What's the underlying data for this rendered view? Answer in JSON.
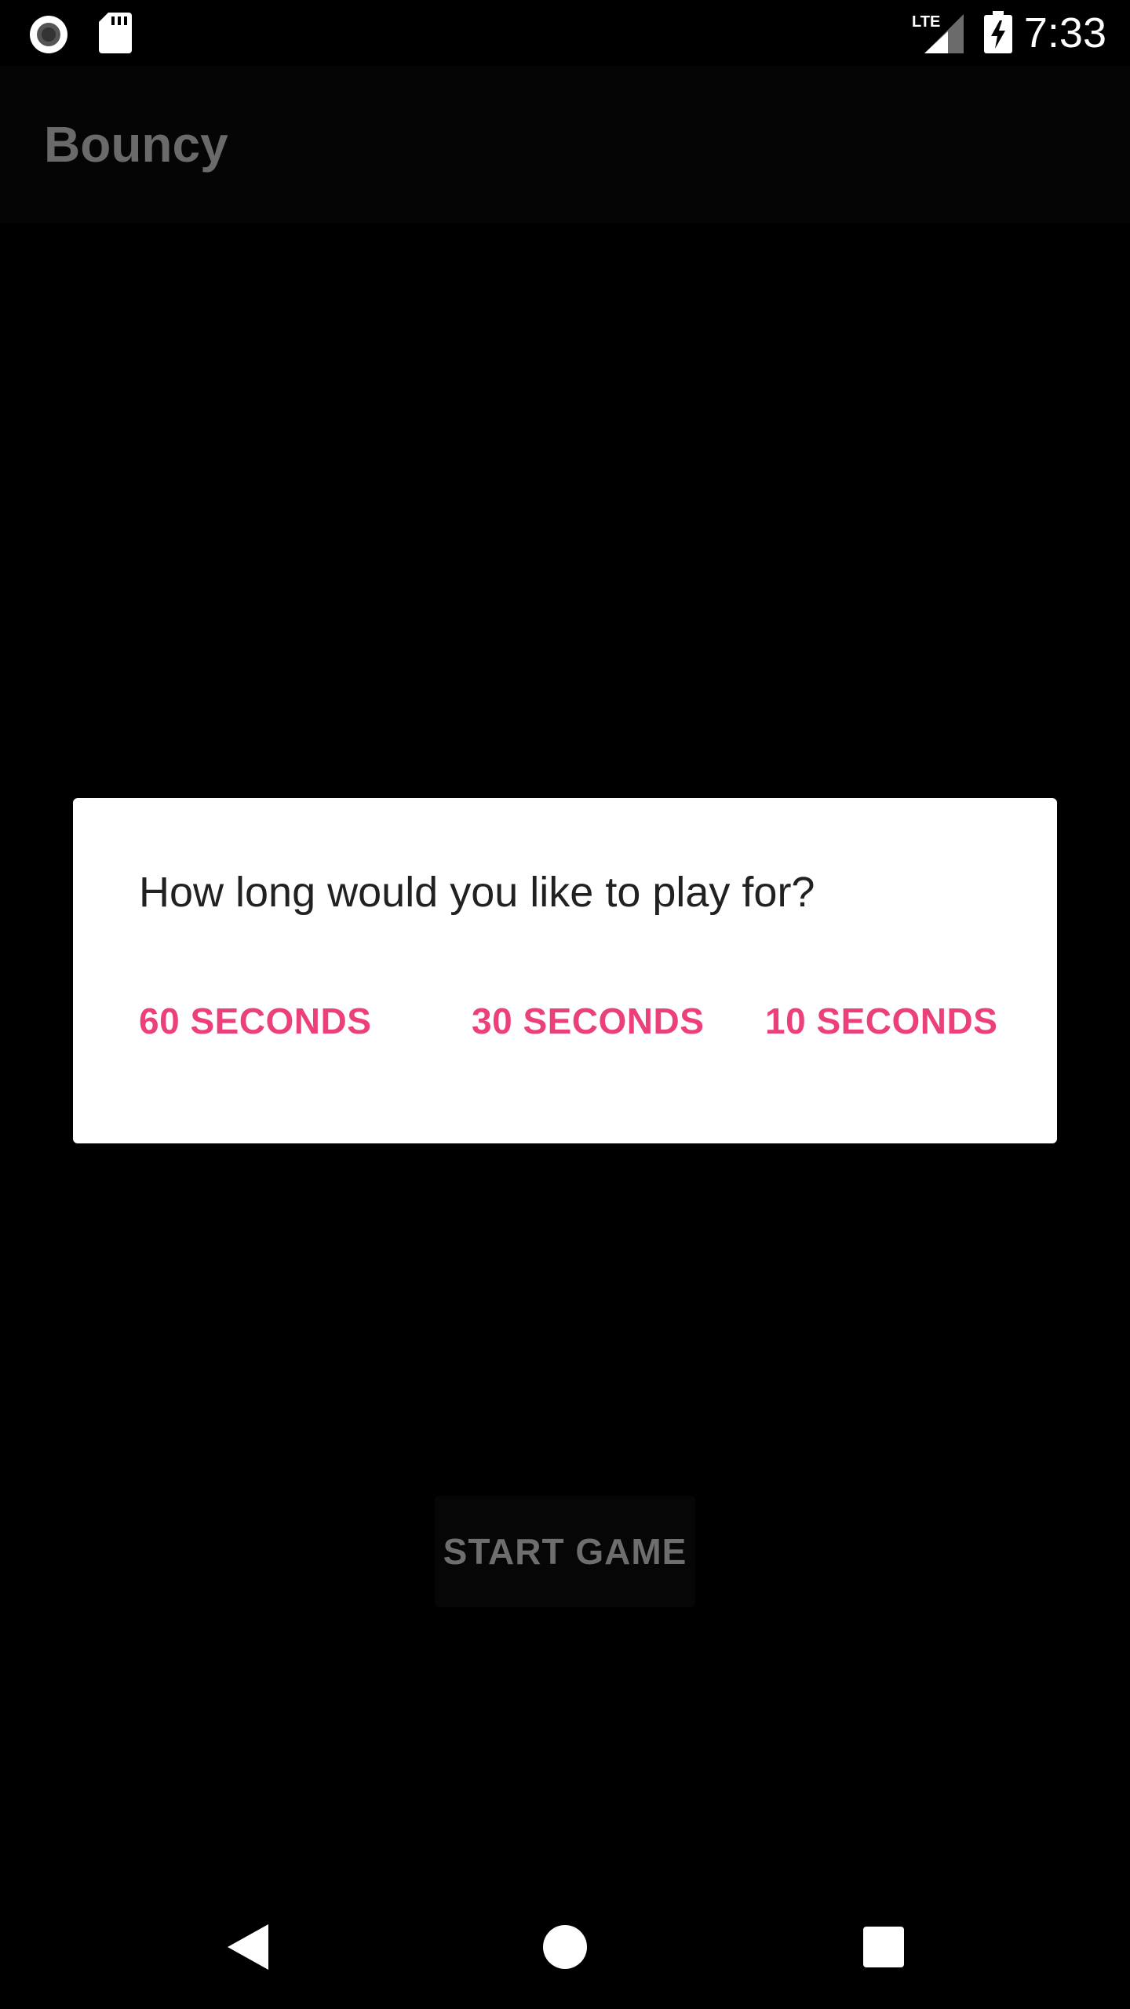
{
  "status_bar": {
    "time": "7:33",
    "icons": [
      "record-icon",
      "sd-card-icon",
      "lte-signal-icon",
      "battery-charging-icon"
    ],
    "network_label": "LTE"
  },
  "app": {
    "title": "Bouncy",
    "start_button_label": "START GAME"
  },
  "dialog": {
    "message": "How long would you like to play for?",
    "options": [
      {
        "label": "60 SECONDS"
      },
      {
        "label": "30 SECONDS"
      },
      {
        "label": "10 SECONDS"
      }
    ],
    "accent_color": "#ec407a"
  },
  "nav_bar": {
    "icons": [
      "back-icon",
      "home-icon",
      "recents-icon"
    ]
  }
}
